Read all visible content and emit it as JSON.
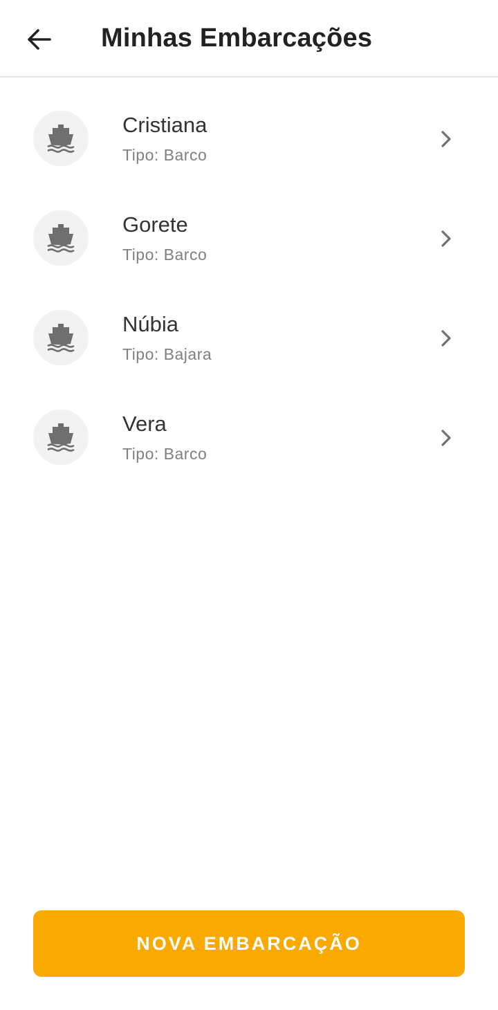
{
  "header": {
    "back_icon": "arrow-left-icon",
    "title": "Minhas Embarcações"
  },
  "vessels": [
    {
      "name": "Cristiana",
      "type": "Tipo: Barco",
      "icon": "boat-icon"
    },
    {
      "name": "Gorete",
      "type": "Tipo: Barco",
      "icon": "boat-icon"
    },
    {
      "name": "Núbia",
      "type": "Tipo: Bajara",
      "icon": "boat-icon"
    },
    {
      "name": "Vera",
      "type": "Tipo: Barco",
      "icon": "boat-icon"
    }
  ],
  "footer": {
    "new_vessel_label": "NOVA EMBARCAÇÃO"
  },
  "colors": {
    "accent": "#FAA900",
    "icon": "#6f6f6f",
    "avatar_bg": "#f2f2f2",
    "secondary_text": "#808080"
  }
}
